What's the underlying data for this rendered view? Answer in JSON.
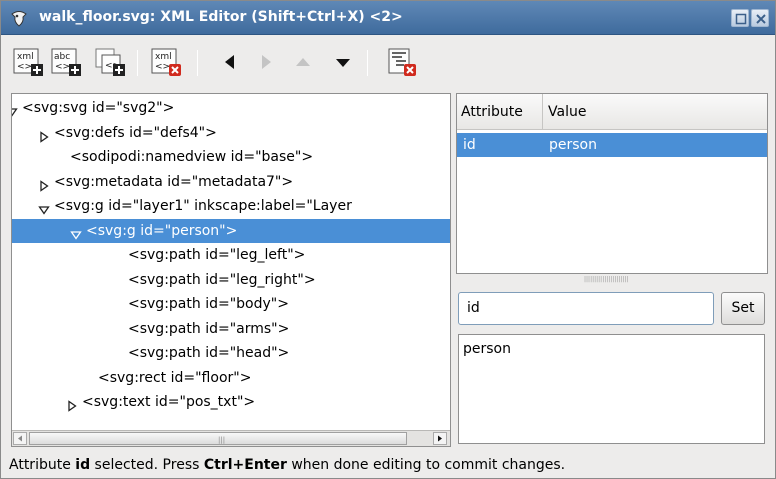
{
  "window": {
    "title": "walk_floor.svg: XML Editor (Shift+Ctrl+X) <2>",
    "app_icon": "inkscape-icon",
    "title_buttons": [
      "maximize-icon",
      "close-icon"
    ]
  },
  "toolbar": {
    "tools": [
      {
        "name": "new-element-node",
        "icon": "xml-new-element-icon",
        "enabled": true
      },
      {
        "name": "new-text-node",
        "icon": "abc-new-text-icon",
        "enabled": true
      },
      {
        "name": "duplicate-node",
        "icon": "duplicate-node-icon",
        "enabled": true
      },
      {
        "name": "delete-node",
        "icon": "xml-delete-icon",
        "enabled": true
      },
      {
        "name": "unindent-node",
        "icon": "arrow-left-icon",
        "enabled": true
      },
      {
        "name": "indent-node",
        "icon": "arrow-right-icon",
        "enabled": false
      },
      {
        "name": "raise-node",
        "icon": "arrow-up-icon",
        "enabled": false
      },
      {
        "name": "lower-node",
        "icon": "arrow-down-icon",
        "enabled": true
      },
      {
        "name": "delete-attribute",
        "icon": "delete-attribute-icon",
        "enabled": true
      }
    ]
  },
  "tree": {
    "nodes": [
      {
        "label": "<svg:svg id=\"svg2\">",
        "expander": "expanded",
        "selected": false
      },
      {
        "label": "<svg:defs id=\"defs4\">",
        "expander": "collapsed",
        "selected": false
      },
      {
        "label": "<sodipodi:namedview id=\"base\">",
        "expander": "none",
        "selected": false
      },
      {
        "label": "<svg:metadata id=\"metadata7\">",
        "expander": "collapsed",
        "selected": false
      },
      {
        "label": "<svg:g id=\"layer1\" inkscape:label=\"Layer",
        "expander": "expanded",
        "selected": false
      },
      {
        "label": "<svg:g id=\"person\">",
        "expander": "expanded",
        "selected": true
      },
      {
        "label": "<svg:path id=\"leg_left\">",
        "expander": "none",
        "selected": false
      },
      {
        "label": "<svg:path id=\"leg_right\">",
        "expander": "none",
        "selected": false
      },
      {
        "label": "<svg:path id=\"body\">",
        "expander": "none",
        "selected": false
      },
      {
        "label": "<svg:path id=\"arms\">",
        "expander": "none",
        "selected": false
      },
      {
        "label": "<svg:path id=\"head\">",
        "expander": "none",
        "selected": false
      },
      {
        "label": "<svg:rect id=\"floor\">",
        "expander": "none",
        "selected": false
      },
      {
        "label": "<svg:text id=\"pos_txt\">",
        "expander": "collapsed",
        "selected": false
      }
    ]
  },
  "attributes": {
    "columns": [
      "Attribute",
      "Value"
    ],
    "rows": [
      {
        "name": "id",
        "value": "person",
        "selected": true
      }
    ]
  },
  "editor": {
    "attribute_name": "id",
    "set_label": "Set",
    "attribute_value": "person"
  },
  "status": {
    "prefix": "Attribute ",
    "attr": "id",
    "middle": " selected. Press ",
    "shortcut": "Ctrl+Enter",
    "suffix": " when done editing to commit changes."
  },
  "colors": {
    "titlebar": "#4f7aab",
    "selection": "#4a8fd6"
  }
}
